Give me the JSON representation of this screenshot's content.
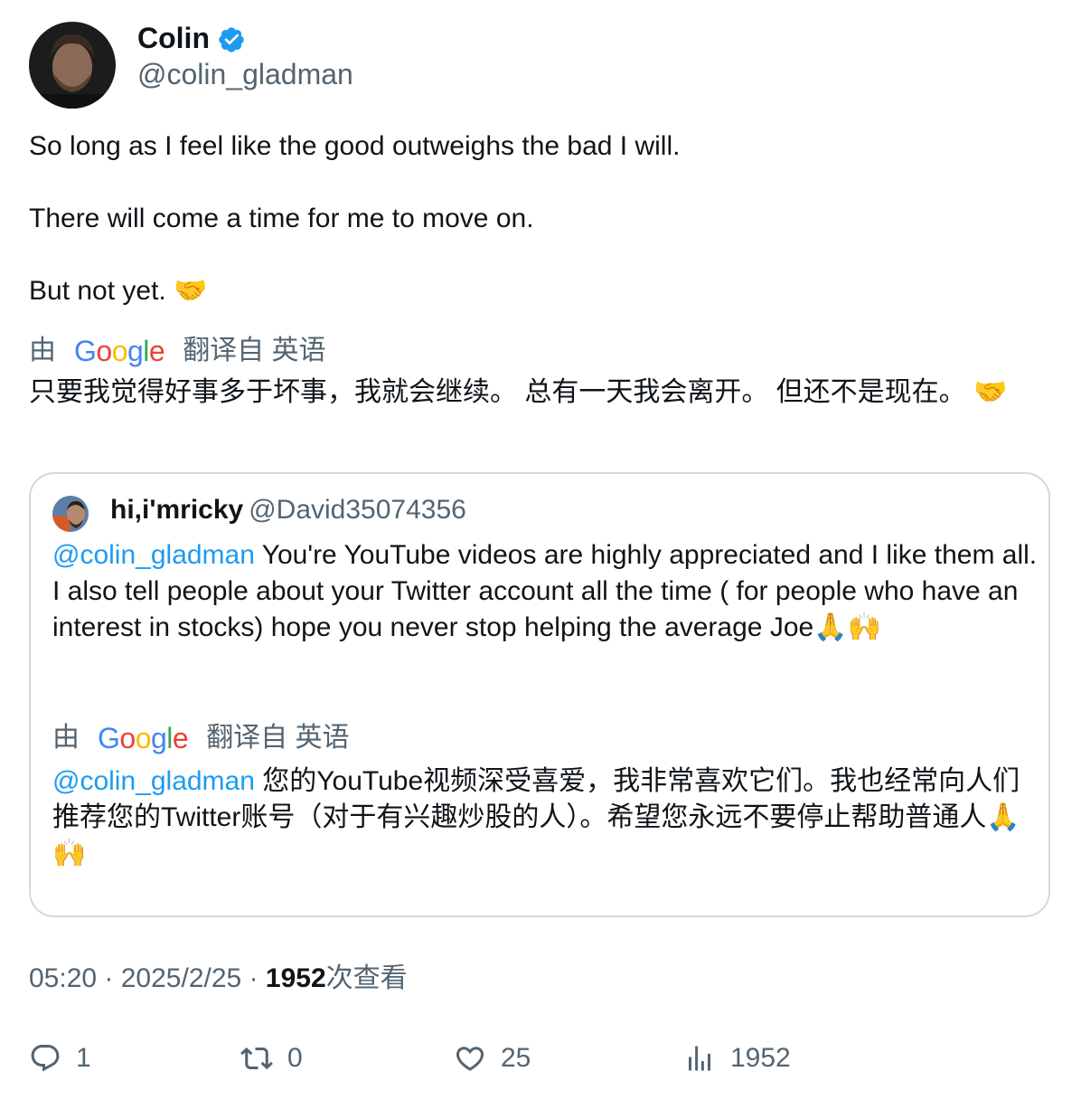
{
  "tweet": {
    "author_name": "Colin",
    "author_handle": "@colin_gladman",
    "lines": [
      "So long as I feel like the good outweighs the bad I will.",
      "There will come a time for me to move on.",
      "But not yet. 🤝"
    ],
    "translate_prefix": "由",
    "translate_suffix": "翻译自 英语",
    "translated_text": "只要我觉得好事多于坏事，我就会继续。 总有一天我会离开。 但还不是现在。 🤝",
    "time": "05:20",
    "date": "2025/2/25",
    "views_count": "1952",
    "views_label": "次查看"
  },
  "quote": {
    "author_name": "hi,i'mricky",
    "author_handle": "@David35074356",
    "mention": "@colin_gladman",
    "text": " You're YouTube videos are highly appreciated and I like them all. I also tell people about your Twitter account all the time ( for people who have an interest in stocks) hope you never stop helping the average Joe🙏🙌",
    "translate_prefix": "由",
    "translate_suffix": "翻译自 英语",
    "translated_mention": "@colin_gladman",
    "translated_text": " 您的YouTube视频深受喜爱，我非常喜欢它们。我也经常向人们推荐您的Twitter账号（对于有兴趣炒股的人）。希望您永远不要停止帮助普通人🙏🙌"
  },
  "google_logo": [
    "G",
    "o",
    "o",
    "g",
    "l",
    "e"
  ],
  "actions": {
    "reply_count": "1",
    "retweet_count": "0",
    "like_count": "25",
    "views_count": "1952"
  },
  "icons": {
    "verified": "verified-badge-icon",
    "reply": "reply-icon",
    "retweet": "retweet-icon",
    "like": "heart-icon",
    "views": "views-chart-icon"
  },
  "colors": {
    "accent": "#1d9bf0",
    "secondary_text": "#536471",
    "border": "#cfd9de"
  }
}
